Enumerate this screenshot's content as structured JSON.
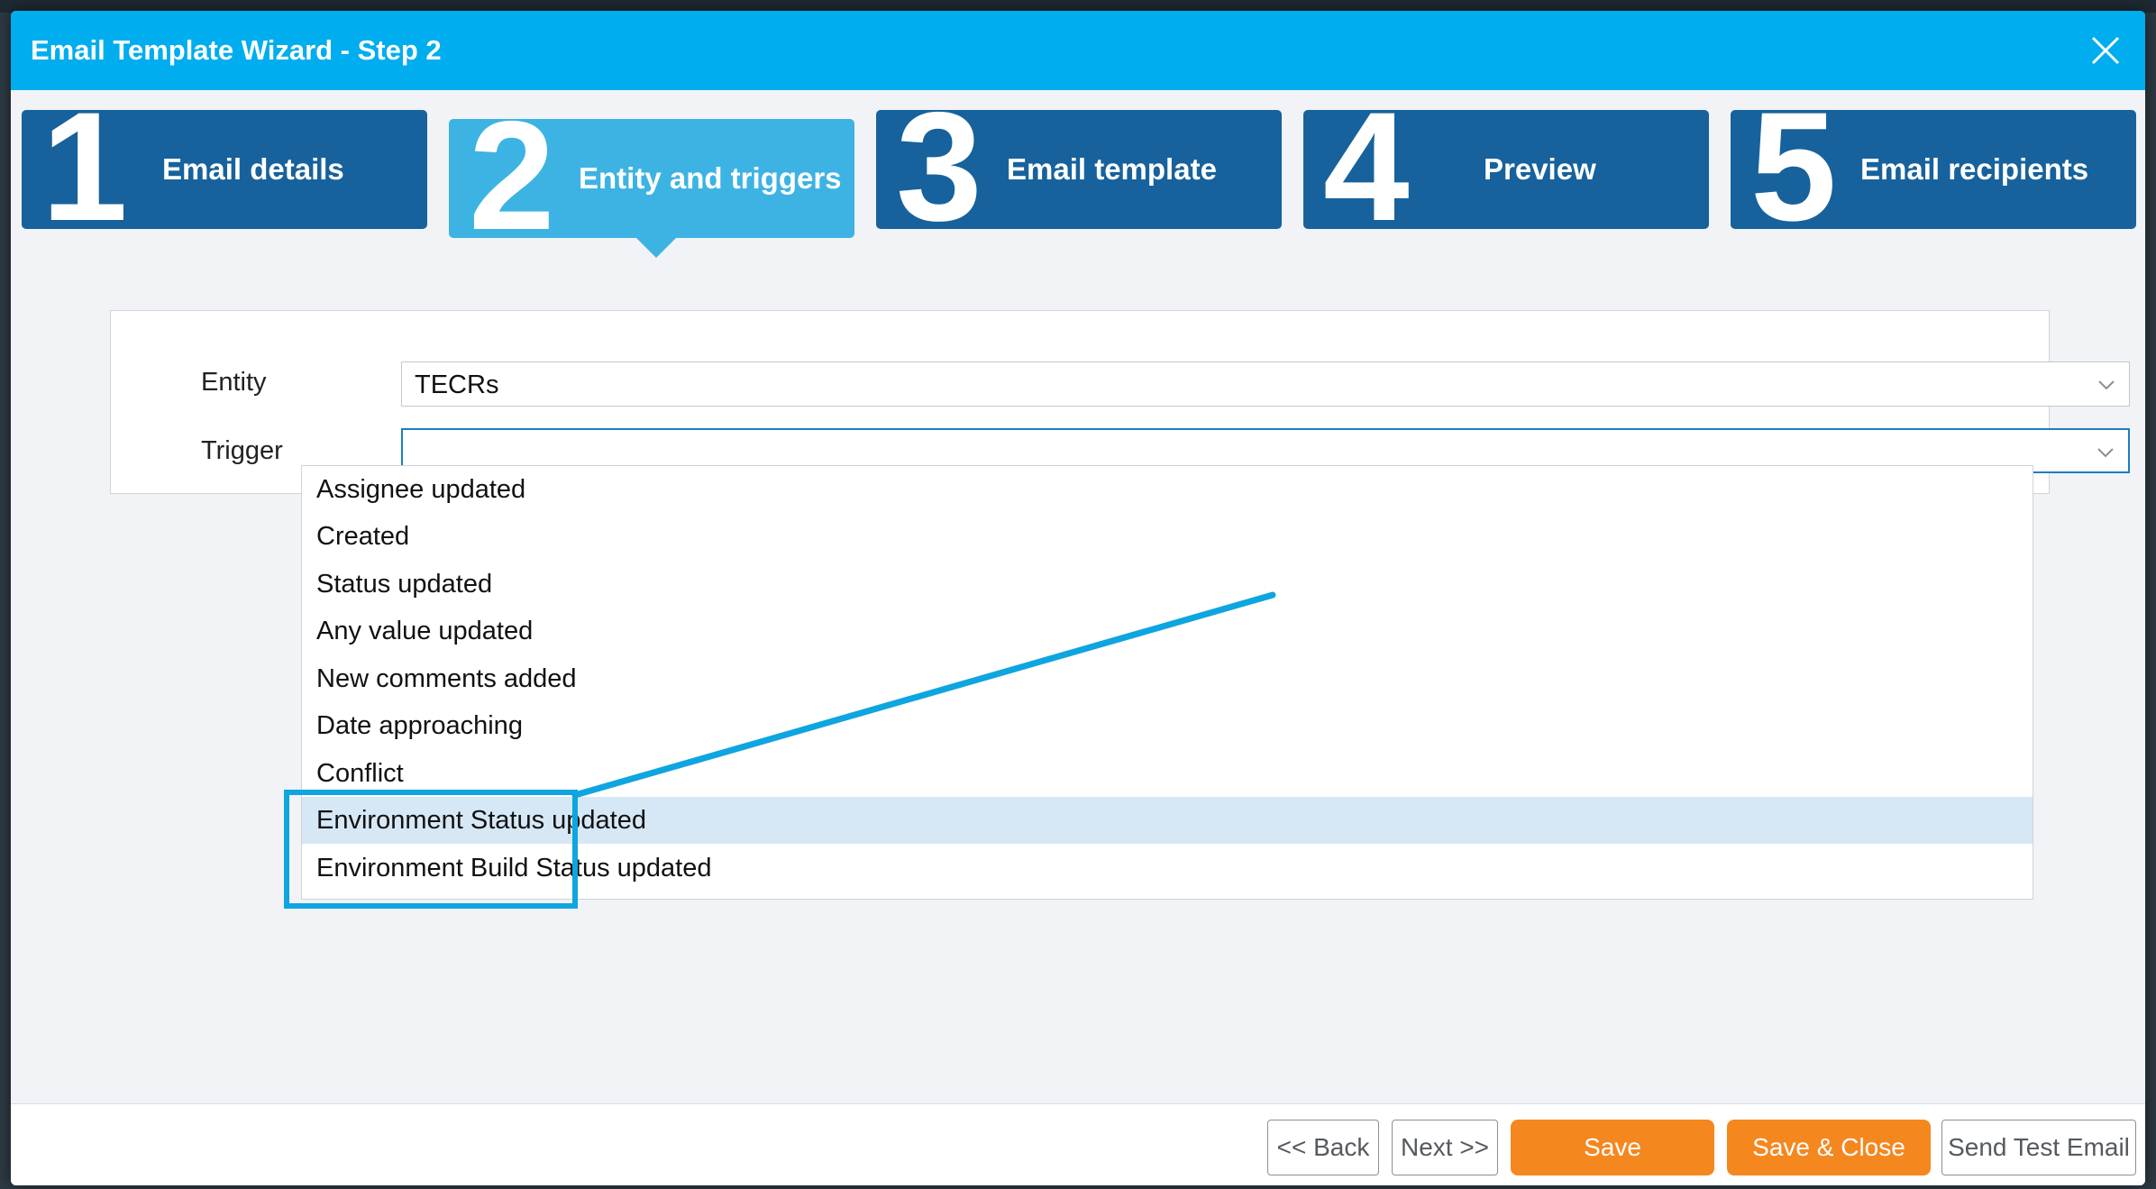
{
  "dialog": {
    "title": "Email Template Wizard - Step 2"
  },
  "steps": [
    {
      "number": "1",
      "label": "Email details",
      "active": false
    },
    {
      "number": "2",
      "label": "Entity and triggers",
      "active": true
    },
    {
      "number": "3",
      "label": "Email template",
      "active": false
    },
    {
      "number": "4",
      "label": "Preview",
      "active": false
    },
    {
      "number": "5",
      "label": "Email recipients",
      "active": false
    }
  ],
  "form": {
    "entity_label": "Entity",
    "entity_value": "TECRs",
    "trigger_label": "Trigger",
    "trigger_value": ""
  },
  "trigger_options": [
    "Assignee updated",
    "Created",
    "Status updated",
    "Any value updated",
    "New comments added",
    "Date approaching",
    "Conflict",
    "Environment Status updated",
    "Environment Build Status updated"
  ],
  "highlighted_option": "Environment Status updated",
  "footer": {
    "back_label": "<< Back",
    "next_label": "Next >>",
    "save_label": "Save",
    "save_close_label": "Save & Close",
    "send_test_label": "Send Test Email"
  },
  "colors": {
    "titlebar": "#00adef",
    "step": "#17629c",
    "step_active": "#3db3e3",
    "primary_button": "#f5871f",
    "annotation": "#0ea5e0",
    "highlight_row": "#d6e8f6"
  },
  "icons": {
    "close": "close-icon",
    "dropdown": "chevron-down-icon"
  }
}
